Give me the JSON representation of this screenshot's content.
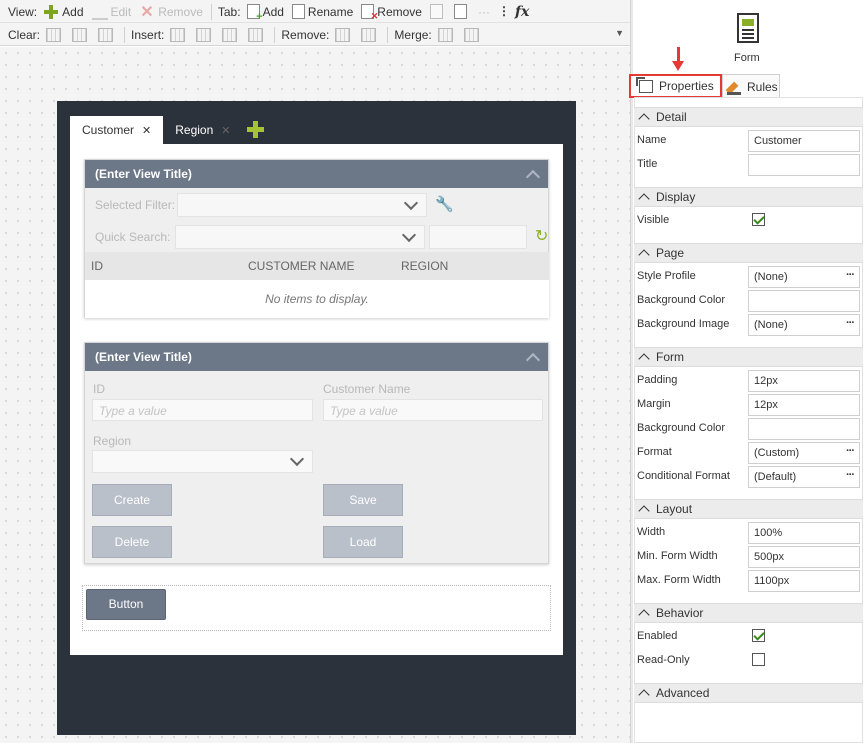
{
  "toolbar": {
    "view_label": "View:",
    "add": "Add",
    "edit": "Edit",
    "remove": "Remove",
    "tab_label": "Tab:",
    "tab_add": "Add",
    "tab_rename": "Rename",
    "tab_remove": "Remove",
    "clear_label": "Clear:",
    "insert_label": "Insert:",
    "remove_label": "Remove:",
    "merge_label": "Merge:"
  },
  "form_tabs": [
    {
      "label": "Customer",
      "close": "✕"
    },
    {
      "label": "Region",
      "close": "✕"
    }
  ],
  "view1": {
    "title": "(Enter View Title)",
    "selected_filter": "Selected Filter:",
    "quick_search": "Quick Search:",
    "columns": [
      "ID",
      "CUSTOMER NAME",
      "REGION"
    ],
    "empty": "No items to display."
  },
  "view2": {
    "title": "(Enter View Title)",
    "id_label": "ID",
    "name_label": "Customer Name",
    "region_label": "Region",
    "placeholder": "Type a value",
    "create": "Create",
    "save": "Save",
    "delete": "Delete",
    "load": "Load"
  },
  "form_button": "Button",
  "panel": {
    "icon_label": "Form",
    "tab_properties": "Properties",
    "tab_rules": "Rules",
    "sections": {
      "detail": "Detail",
      "display": "Display",
      "page": "Page",
      "form": "Form",
      "layout": "Layout",
      "behavior": "Behavior",
      "advanced": "Advanced"
    },
    "props": {
      "name_label": "Name",
      "name_value": "Customer",
      "title_label": "Title",
      "title_value": "",
      "visible_label": "Visible",
      "style_profile_label": "Style Profile",
      "style_profile_value": "(None)",
      "bg_color_label": "Background Color",
      "bg_image_label": "Background Image",
      "bg_image_value": "(None)",
      "padding_label": "Padding",
      "padding_value": "12px",
      "margin_label": "Margin",
      "margin_value": "12px",
      "form_bg_color_label": "Background Color",
      "format_label": "Format",
      "format_value": "(Custom)",
      "cond_format_label": "Conditional Format",
      "cond_format_value": "(Default)",
      "width_label": "Width",
      "width_value": "100%",
      "min_width_label": "Min. Form Width",
      "min_width_value": "500px",
      "max_width_label": "Max. Form Width",
      "max_width_value": "1100px",
      "enabled_label": "Enabled",
      "readonly_label": "Read-Only"
    },
    "dots": "···"
  },
  "colors": {
    "header": "#6c7788",
    "frame": "#2b323c",
    "highlight": "#e53935",
    "add_green": "#7aa51d"
  }
}
